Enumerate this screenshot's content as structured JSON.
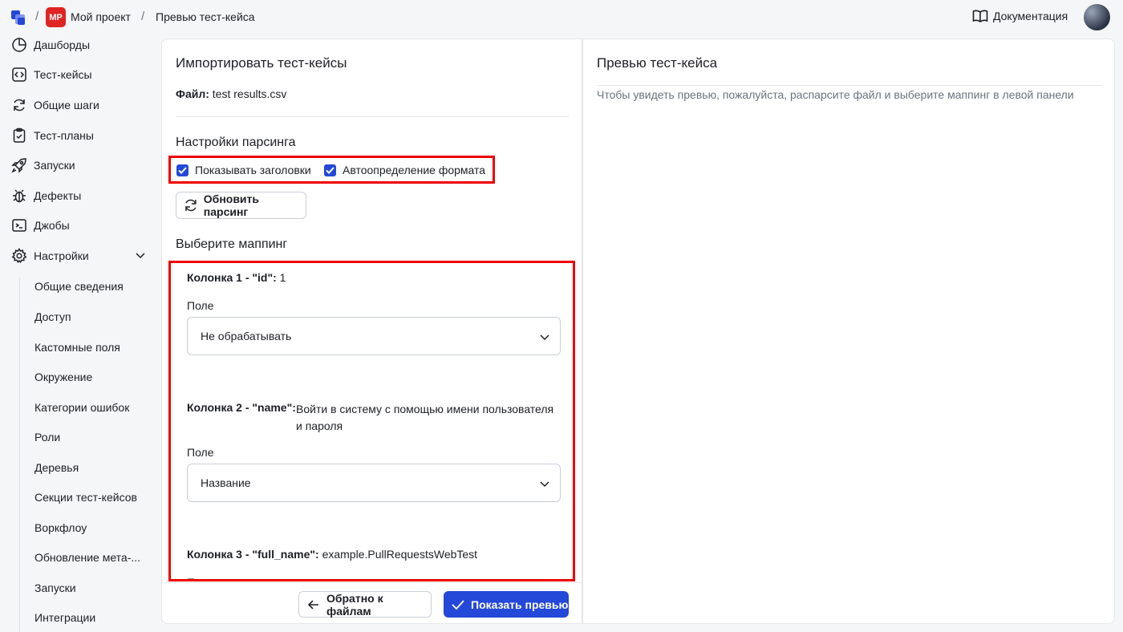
{
  "breadcrumb": {
    "separator": "/",
    "project_badge": "MP",
    "project_name": "Мой проект",
    "page_name": "Превью тест-кейса"
  },
  "header": {
    "docs_label": "Документация"
  },
  "sidebar": {
    "items": [
      {
        "label": "Дашборды",
        "icon": "pie-chart-icon"
      },
      {
        "label": "Тест-кейсы",
        "icon": "code-icon"
      },
      {
        "label": "Общие шаги",
        "icon": "refresh-icon"
      },
      {
        "label": "Тест-планы",
        "icon": "clipboard-check-icon"
      },
      {
        "label": "Запуски",
        "icon": "rocket-icon"
      },
      {
        "label": "Дефекты",
        "icon": "bug-icon"
      },
      {
        "label": "Джобы",
        "icon": "terminal-icon"
      },
      {
        "label": "Настройки",
        "icon": "gear-icon"
      }
    ],
    "settings_sub": [
      "Общие сведения",
      "Доступ",
      "Кастомные поля",
      "Окружение",
      "Категории ошибок",
      "Роли",
      "Деревья",
      "Секции тест-кейсов",
      "Воркфлоу",
      "Обновление мета-...",
      "Запуски",
      "Интеграции"
    ]
  },
  "import": {
    "title": "Импортировать тест-кейсы",
    "file_label": "Файл:",
    "file_name": "test results.csv",
    "parsing_title": "Настройки парсинга",
    "show_headers_label": "Показывать заголовки",
    "autodetect_label": "Автоопределение формата",
    "refresh_label": "Обновить парсинг",
    "mapping_title": "Выберите маппинг",
    "field_label": "Поле",
    "columns": [
      {
        "header": "Колонка 1 - \"id\":",
        "value": "1",
        "field": "Не обрабатывать"
      },
      {
        "header": "Колонка 2 - \"name\":",
        "value": "Войти в систему с помощью имени пользователя",
        "value2": "и пароля",
        "field": "Название"
      },
      {
        "header": "Колонка 3 - \"full_name\":",
        "value": "example.PullRequestsWebTest",
        "field": ""
      }
    ],
    "back_label": "Обратно к файлам",
    "preview_label": "Показать превью"
  },
  "preview": {
    "title": "Превью тест-кейса",
    "hint": "Чтобы увидеть превью, пожалуйста, распарсите файл и выберите маппинг в левой панели"
  },
  "colors": {
    "accent": "#2448d8",
    "highlight": "#ee0000",
    "badge": "#e02424"
  }
}
